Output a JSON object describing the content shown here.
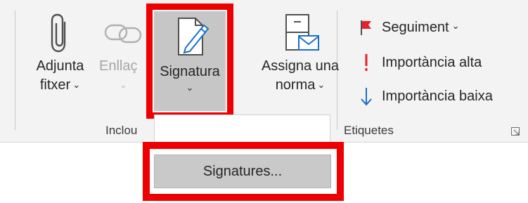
{
  "include_group": {
    "label": "Inclou",
    "attach": {
      "line1": "Adjunta",
      "line2": "fitxer",
      "icon": "paperclip-icon"
    },
    "link": {
      "line1": "Enllaç",
      "icon": "link-icon"
    },
    "signature": {
      "label": "Signatura",
      "icon": "signature-pen-icon"
    }
  },
  "tags_group": {
    "label": "Etiquetes",
    "assign_policy": {
      "line1": "Assigna una",
      "line2": "norma",
      "icon": "retention-policy-icon"
    },
    "follow_up": "Seguiment",
    "high_importance": "Importància alta",
    "low_importance": "Importància baixa"
  },
  "signature_menu": {
    "items": [
      "Signatures..."
    ]
  },
  "colors": {
    "highlight": "#ee0000",
    "flag": "#e8202a",
    "low_arrow": "#1a6fc9",
    "button_pressed": "#c6c6c6"
  }
}
